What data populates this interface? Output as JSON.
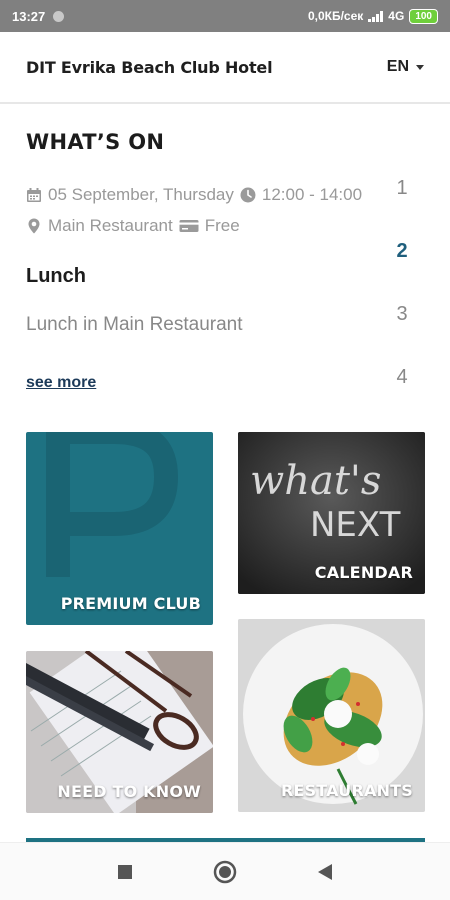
{
  "status_bar": {
    "time": "13:27",
    "network_speed": "0,0КБ/сек",
    "network_type": "4G",
    "battery": "100"
  },
  "header": {
    "hotel_name": "DIT Evrika Beach Club Hotel",
    "language": "EN"
  },
  "whats_on": {
    "title": "WHAT’S ON",
    "date": "05 September, Thursday",
    "time": "12:00 - 14:00",
    "location": "Main Restaurant",
    "price": "Free",
    "event_title": "Lunch",
    "event_description": "Lunch in Main Restaurant",
    "see_more": "see more",
    "pages": [
      "1",
      "2",
      "3",
      "4"
    ],
    "active_page": 2
  },
  "tiles": [
    {
      "label": "PREMIUM CLUB",
      "icon": "premium-p-icon"
    },
    {
      "label": "CALENDAR",
      "chalk_text_1": "what's",
      "chalk_text_2": "NEXT"
    },
    {
      "label": "NEED TO KNOW"
    },
    {
      "label": "RESTAURANTS"
    }
  ],
  "colors": {
    "accent": "#1e7282",
    "link": "#1c3a59",
    "active_page": "#1f5f7d"
  }
}
